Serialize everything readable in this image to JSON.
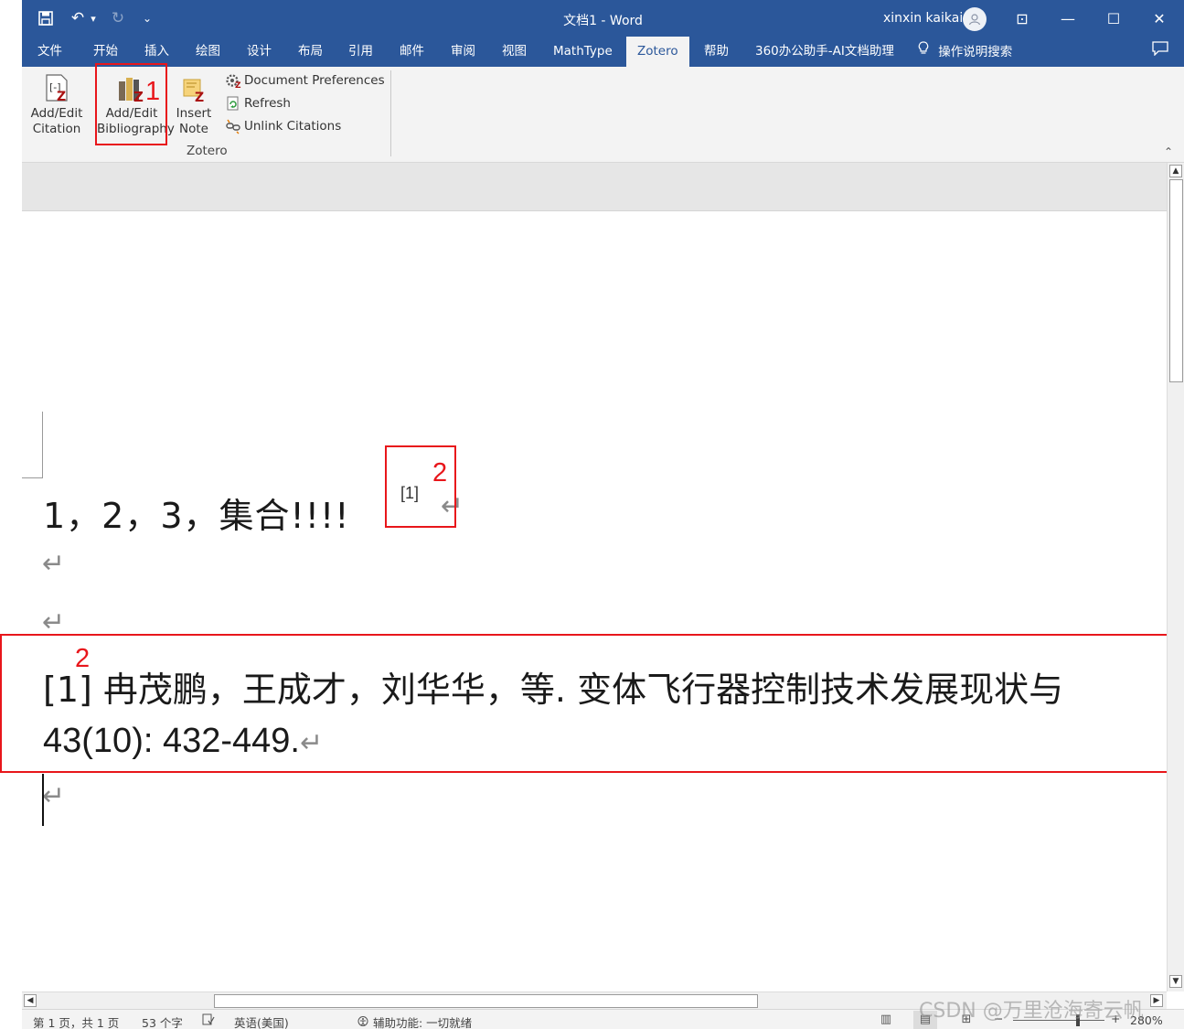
{
  "window": {
    "title": "文档1  -  Word",
    "user_name": "xinxin kaikai",
    "avatar_icon": "user-avatar-icon",
    "ribbon_display_icon": "⊡",
    "minimize_icon": "—",
    "maximize_icon": "☐",
    "close_icon": "✕",
    "accent_color": "#2b579a"
  },
  "quick_access": {
    "save_icon": "🖫",
    "undo_icon": "↶",
    "undo_dropdown": "▾",
    "redo_icon": "↻",
    "customize_icon": "⌄"
  },
  "tabs": [
    {
      "label": "文件"
    },
    {
      "label": "开始"
    },
    {
      "label": "插入"
    },
    {
      "label": "绘图"
    },
    {
      "label": "设计"
    },
    {
      "label": "布局"
    },
    {
      "label": "引用"
    },
    {
      "label": "邮件"
    },
    {
      "label": "审阅"
    },
    {
      "label": "视图"
    },
    {
      "label": "MathType"
    },
    {
      "label": "Zotero"
    },
    {
      "label": "帮助"
    },
    {
      "label": "360办公助手-AI文档助理"
    }
  ],
  "tell_me": "操作说明搜索",
  "ribbon": {
    "add_edit_citation": "Add/Edit\nCitation",
    "add_edit_bibliography": "Add/Edit\nBibliography",
    "insert_note": "Insert\nNote",
    "document_preferences": "Document Preferences",
    "refresh": "Refresh",
    "unlink_citations": "Unlink Citations",
    "group_label": "Zotero",
    "collapse_icon": "⌃"
  },
  "annotations": {
    "label_1": "1",
    "label_2a": "2",
    "label_2b": "2",
    "color": "#e8161b"
  },
  "document": {
    "paragraph_1": "1，2，3，集合!!!!",
    "citation": "[1]",
    "pilcrow": "↵",
    "bib_line_1": "[1]    冉茂鹏，王成才，刘华华，等. 变体飞行器控制技术发展现状与",
    "bib_line_2": "43(10): 432-449."
  },
  "status": {
    "page": "第 1 页，共 1 页",
    "words": "53 个字",
    "language": "英语(美国)",
    "accessibility": "辅助功能: 一切就绪",
    "zoom": "280%",
    "zoom_minus": "−",
    "zoom_plus": "+"
  },
  "watermark": "CSDN @万里沧海寄云帆"
}
